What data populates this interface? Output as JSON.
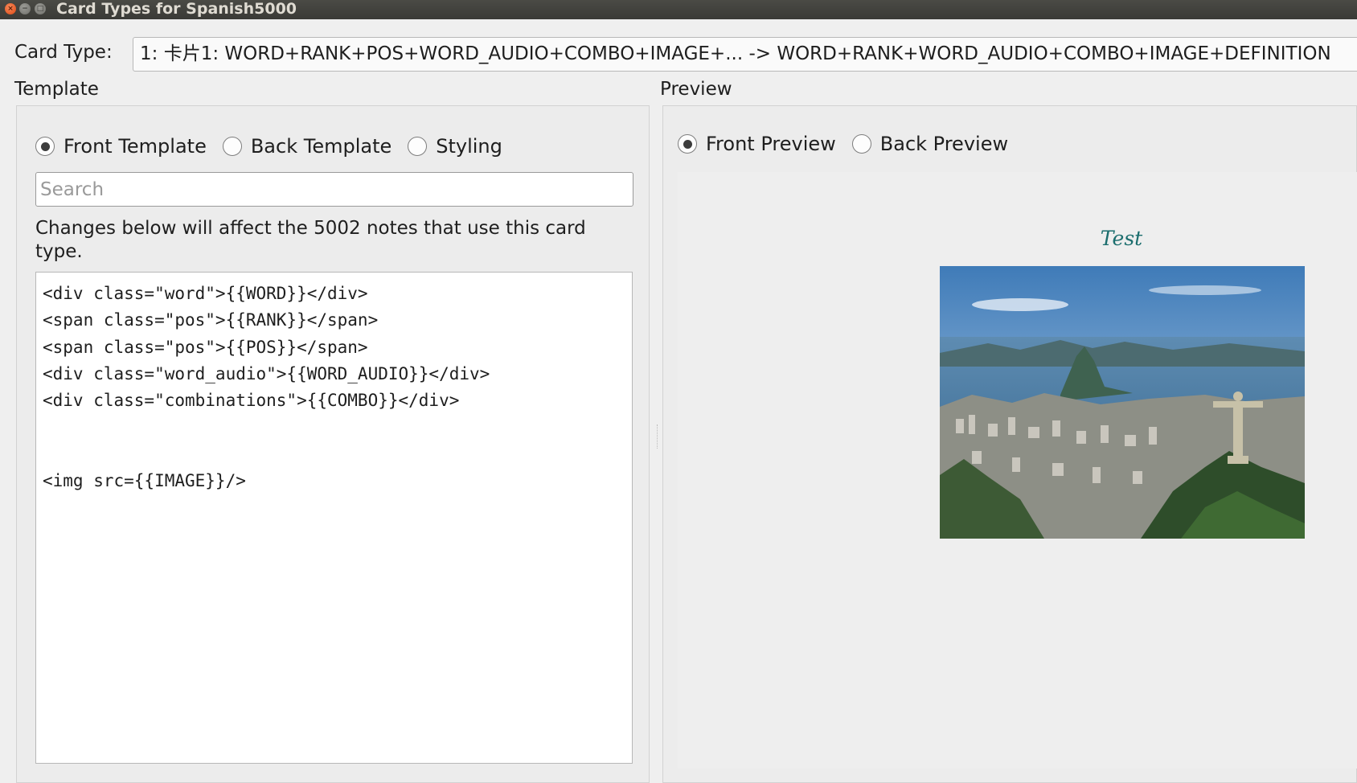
{
  "window": {
    "title": "Card Types for Spanish5000",
    "controls": {
      "close": "×",
      "minimize": "−",
      "maximize": "□"
    }
  },
  "card_type": {
    "label": "Card Type:",
    "selected": "1: 卡片1: WORD+RANK+POS+WORD_AUDIO+COMBO+IMAGE+... -> WORD+RANK+WORD_AUDIO+COMBO+IMAGE+DEFINITION"
  },
  "template": {
    "section_label": "Template",
    "radios": [
      {
        "label": "Front Template",
        "checked": true
      },
      {
        "label": "Back Template",
        "checked": false
      },
      {
        "label": "Styling",
        "checked": false
      }
    ],
    "search_placeholder": "Search",
    "notice": "Changes below will affect the 5002 notes that use this card type.",
    "editor_content": "<div class=\"word\">{{WORD}}</div>\n<span class=\"pos\">{{RANK}}</span>\n<span class=\"pos\">{{POS}}</span>\n<div class=\"word_audio\">{{WORD_AUDIO}}</div>\n<div class=\"combinations\">{{COMBO}}</div>\n\n\n<img src={{IMAGE}}/>"
  },
  "preview": {
    "section_label": "Preview",
    "radios": [
      {
        "label": "Front Preview",
        "checked": true
      },
      {
        "label": "Back Preview",
        "checked": false
      }
    ],
    "card_title": "Test",
    "image_subject": "rio-de-janeiro-christ-the-redeemer-photo"
  },
  "colors": {
    "titlebar": "#3c3b37",
    "title_text": "#dfdbd2",
    "close_button": "#dd4814",
    "preview_title": "#1c6e6e",
    "background": "#efefef"
  }
}
